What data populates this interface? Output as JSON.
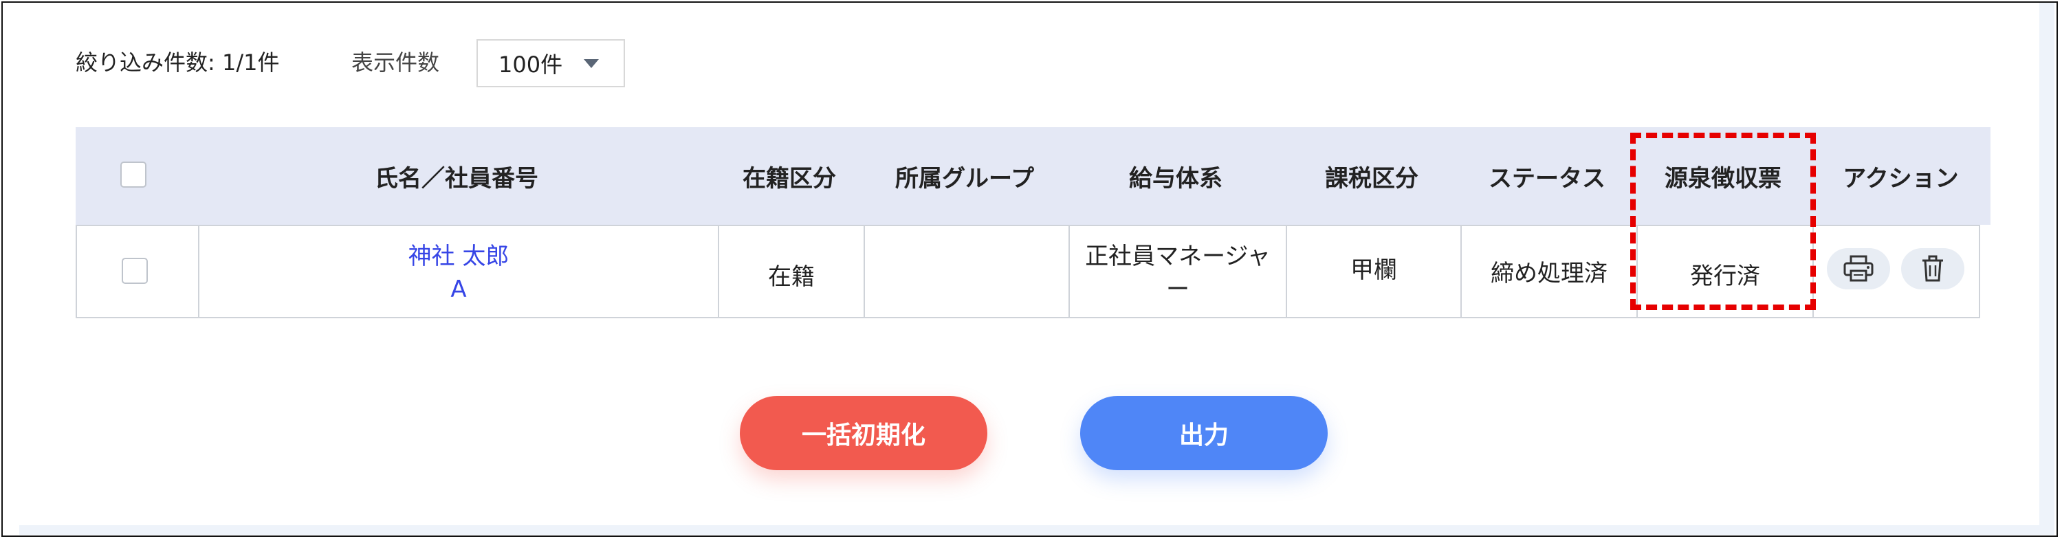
{
  "toolbar": {
    "filter_count_label": "絞り込み件数: 1/1件",
    "display_count_label": "表示件数",
    "display_count_value": "100件"
  },
  "table": {
    "headers": [
      "氏名／社員番号",
      "在籍区分",
      "所属グループ",
      "給与体系",
      "課税区分",
      "ステータス",
      "源泉徴収票",
      "アクション"
    ],
    "rows": [
      {
        "name": "神社 太郎",
        "employee_no": "A",
        "enrollment": "在籍",
        "group": "",
        "pay_system_line1": "正社員マネージャ",
        "pay_system_line2": "ー",
        "tax_class": "甲欄",
        "status": "締め処理済",
        "withholding_slip": "発行済"
      }
    ]
  },
  "actions": {
    "reset_label": "一括初期化",
    "export_label": "出力"
  },
  "icons": {
    "print": "printer-icon",
    "delete": "trash-icon",
    "dropdown": "caret-down-icon"
  },
  "colors": {
    "header_bg": "#e4e8f5",
    "link": "#3645e6",
    "reset_button": "#f25a4f",
    "export_button": "#4f86f7",
    "highlight": "#e60000"
  }
}
